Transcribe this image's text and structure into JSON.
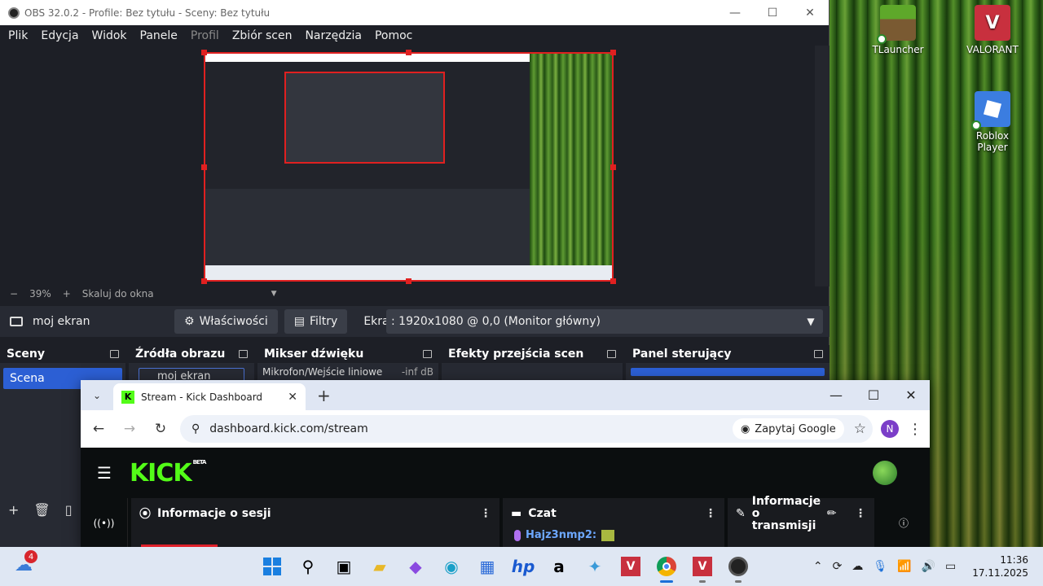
{
  "obs": {
    "title": "OBS 32.0.2 - Profile: Bez tytułu - Sceny: Bez tytułu",
    "window_controls": [
      "—",
      "☐",
      "✕"
    ],
    "menu": [
      "Plik",
      "Edycja",
      "Widok",
      "Panele",
      "Profil",
      "Zbiór scen",
      "Narzędzia",
      "Pomoc"
    ],
    "zoom": {
      "minus": "−",
      "value": "39%",
      "plus": "+",
      "fit": "Skaluj do okna",
      "caret": "▼"
    },
    "source_bar": {
      "source_name": "moj ekran",
      "properties": "Właściwości",
      "filters": "Filtry",
      "screen_label": "Ekran",
      "screen_value": ": 1920x1080 @ 0,0 (Monitor główny)",
      "caret": "▼"
    },
    "docks": {
      "scenes": {
        "title": "Sceny",
        "items": [
          "Scena"
        ],
        "tools": [
          "+",
          "🗑",
          "▯"
        ]
      },
      "sources": {
        "title": "Źródła obrazu",
        "items": [
          "moj ekran"
        ]
      },
      "mixer": {
        "title": "Mikser dźwięku",
        "items": [
          {
            "name": "Mikrofon/Wejście liniowe",
            "level": "-inf dB"
          }
        ]
      },
      "transitions": {
        "title": "Efekty przejścia scen"
      },
      "controls": {
        "title": "Panel sterujący"
      }
    }
  },
  "desktop_icons": [
    {
      "label": "TLauncher",
      "color": "#5a8a2a"
    },
    {
      "label": "VALORANT",
      "color": "#d13a4a"
    },
    {
      "label": "Roblox Player",
      "color": "#3b7de0"
    }
  ],
  "chrome": {
    "tab_title": "Stream - Kick Dashboard",
    "tab_close": "✕",
    "new_tab": "+",
    "tab_menu": "⌄",
    "window_controls": [
      "—",
      "☐",
      "✕"
    ],
    "url": "dashboard.kick.com/stream",
    "google_chip": "Zapytaj Google",
    "profile_initial": "N",
    "kick": {
      "logo": "KICK",
      "beta": "BETA",
      "session_panel": "Informacje o sesji",
      "chat_panel": "Czat",
      "stream_info_panel": "Informacje o transmisji",
      "chat_user": "Hajz3nmp2:",
      "brand_color": "#53fc18"
    }
  },
  "taskbar": {
    "notifications": "4",
    "clock_time": "11:36",
    "clock_date": "17.11.2025",
    "apps": [
      "windows-start",
      "search",
      "task-view",
      "file-explorer",
      "m365",
      "edge",
      "store",
      "hp",
      "amazon",
      "copilot",
      "valorant",
      "chrome",
      "valorant-2",
      "obs"
    ]
  }
}
